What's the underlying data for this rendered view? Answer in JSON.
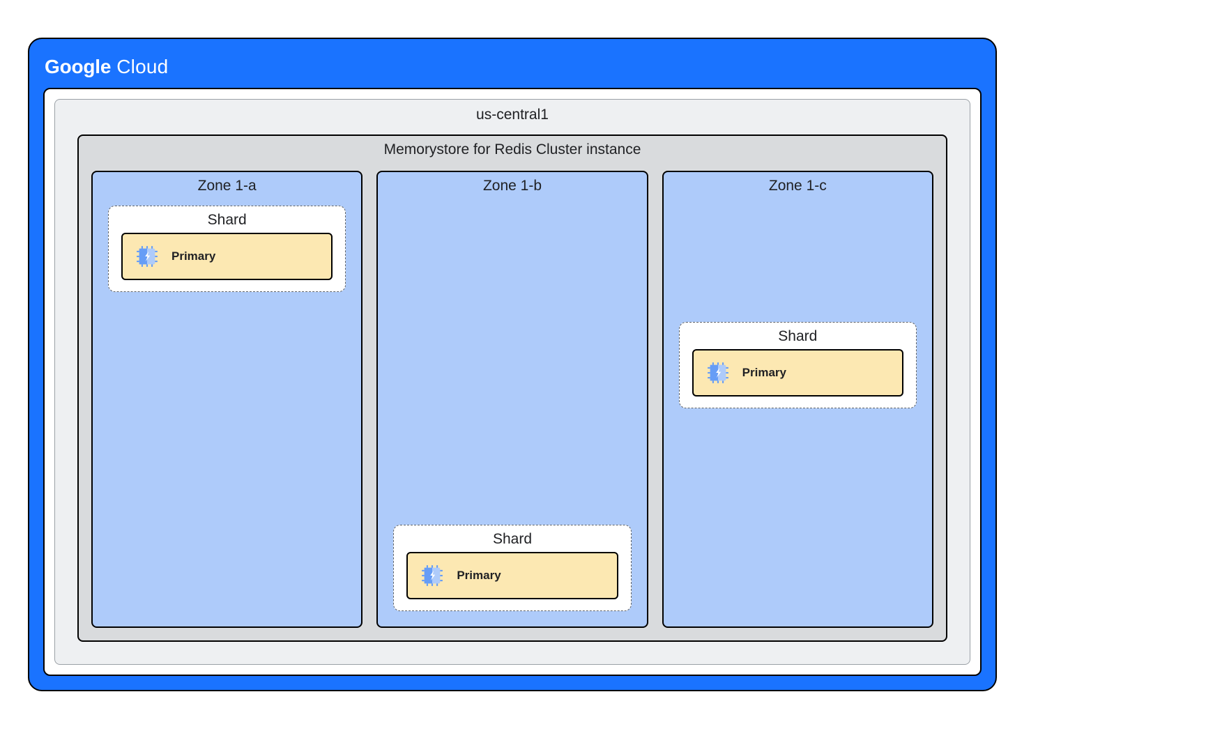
{
  "brand": {
    "name_bold": "Google",
    "name_rest": " Cloud"
  },
  "region": {
    "label": "us-central1"
  },
  "cluster": {
    "label": "Memorystore for Redis Cluster instance"
  },
  "zones": [
    {
      "label": "Zone 1-a",
      "shard": {
        "label": "Shard",
        "primary_label": "Primary",
        "position": "top"
      }
    },
    {
      "label": "Zone 1-b",
      "shard": {
        "label": "Shard",
        "primary_label": "Primary",
        "position": "bottom"
      }
    },
    {
      "label": "Zone 1-c",
      "shard": {
        "label": "Shard",
        "primary_label": "Primary",
        "position": "middle"
      }
    }
  ]
}
